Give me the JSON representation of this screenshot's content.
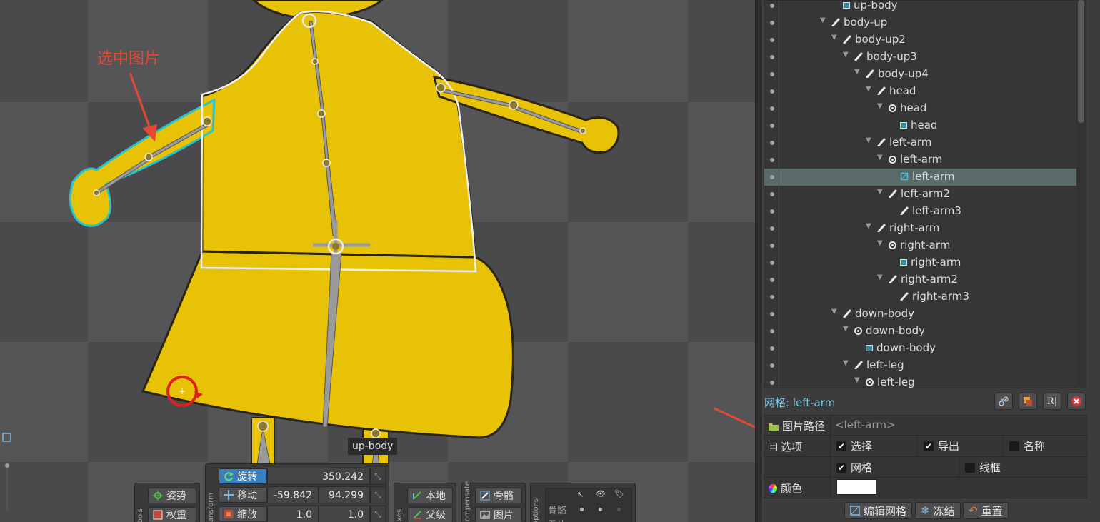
{
  "annotation": {
    "label": "选中图片"
  },
  "viewport": {
    "bone_tooltip": "up-body"
  },
  "tools_group": {
    "title": "Tools",
    "pose": "姿势",
    "weights": "权重"
  },
  "transform_group": {
    "title": "Transform",
    "rotate": {
      "label": "旋转",
      "value": "350.242"
    },
    "translate": {
      "label": "移动",
      "x": "-59.842",
      "y": "94.299"
    },
    "scale": {
      "label": "缩放",
      "x": "1.0",
      "y": "1.0"
    }
  },
  "axes_group": {
    "title": "Axes",
    "local": "本地",
    "parent": "父级"
  },
  "compensate_group": {
    "title": "Compensate",
    "bones": "骨骼",
    "images": "图片"
  },
  "options_group": {
    "title": "Options",
    "bones": "骨骼",
    "images": "图片"
  },
  "tree": {
    "items": [
      {
        "label": "up-body",
        "icon": "region-icon",
        "depth": 6,
        "expander": ""
      },
      {
        "label": "body-up",
        "icon": "bone-icon",
        "depth": 5,
        "expander": "▼"
      },
      {
        "label": "body-up2",
        "icon": "bone-icon",
        "depth": 6,
        "expander": "▼"
      },
      {
        "label": "body-up3",
        "icon": "bone-icon",
        "depth": 7,
        "expander": "▼"
      },
      {
        "label": "body-up4",
        "icon": "bone-icon",
        "depth": 8,
        "expander": "▼"
      },
      {
        "label": "head",
        "icon": "bone-icon",
        "depth": 9,
        "expander": "▼"
      },
      {
        "label": "head",
        "icon": "slot-icon",
        "depth": 10,
        "expander": "▼"
      },
      {
        "label": "head",
        "icon": "region-icon",
        "depth": 11,
        "expander": ""
      },
      {
        "label": "left-arm",
        "icon": "bone-icon",
        "depth": 9,
        "expander": "▼"
      },
      {
        "label": "left-arm",
        "icon": "slot-icon",
        "depth": 10,
        "expander": "▼"
      },
      {
        "label": "left-arm",
        "icon": "mesh-icon",
        "depth": 11,
        "expander": "",
        "selected": true
      },
      {
        "label": "left-arm2",
        "icon": "bone-icon",
        "depth": 10,
        "expander": "▼"
      },
      {
        "label": "left-arm3",
        "icon": "bone-icon",
        "depth": 11,
        "expander": ""
      },
      {
        "label": "right-arm",
        "icon": "bone-icon",
        "depth": 9,
        "expander": "▼"
      },
      {
        "label": "right-arm",
        "icon": "slot-icon",
        "depth": 10,
        "expander": "▼"
      },
      {
        "label": "right-arm",
        "icon": "region-icon",
        "depth": 11,
        "expander": ""
      },
      {
        "label": "right-arm2",
        "icon": "bone-icon",
        "depth": 10,
        "expander": "▼"
      },
      {
        "label": "right-arm3",
        "icon": "bone-icon",
        "depth": 11,
        "expander": ""
      },
      {
        "label": "down-body",
        "icon": "bone-icon",
        "depth": 6,
        "expander": "▼"
      },
      {
        "label": "down-body",
        "icon": "slot-icon",
        "depth": 7,
        "expander": "▼"
      },
      {
        "label": "down-body",
        "icon": "region-icon",
        "depth": 8,
        "expander": ""
      },
      {
        "label": "left-leg",
        "icon": "bone-icon",
        "depth": 7,
        "expander": "▼"
      },
      {
        "label": "left-leg",
        "icon": "slot-icon",
        "depth": 8,
        "expander": "▼"
      }
    ]
  },
  "properties": {
    "title": "网格: left-arm",
    "image_path_label": "图片路径",
    "image_path_value": "<left-arm>",
    "options_label": "选项",
    "select_label": "选择",
    "export_label": "导出",
    "name_label": "名称",
    "mesh_label": "网格",
    "wireframe_label": "线框",
    "color_label": "颜色",
    "select_checked": true,
    "export_checked": true,
    "name_checked": false,
    "mesh_checked": true,
    "wireframe_checked": false,
    "color_value": "#ffffff",
    "edit_mesh_button": "编辑网格",
    "freeze_button": "冻结",
    "reset_button": "重置",
    "header_buttons": [
      "link-icon",
      "paint-icon",
      "rename-icon",
      "delete-icon"
    ]
  },
  "colors": {
    "character_fill": "#e8c207",
    "accent_blue": "#3c7dbd",
    "annotation_red": "#e24a36",
    "selection_cyan": "#27c5cc",
    "title_cyan": "#7ec8e6"
  }
}
